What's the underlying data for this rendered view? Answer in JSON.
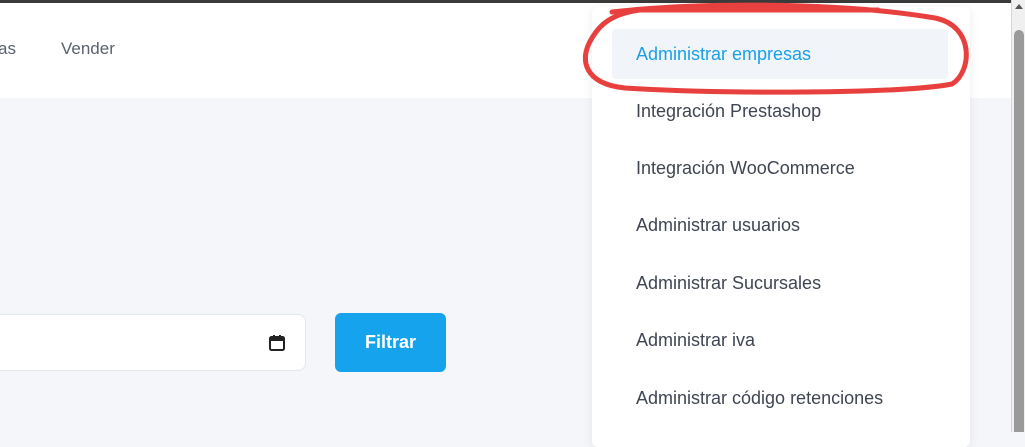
{
  "navbar": {
    "partial_link": "as",
    "sell_link": "Vender"
  },
  "filter": {
    "button_label": "Filtrar",
    "date_icon": "calendar-icon"
  },
  "dropdown": {
    "items": [
      {
        "label": "Administrar empresas",
        "active": true
      },
      {
        "label": "Integración Prestashop"
      },
      {
        "label": "Integración WooCommerce"
      },
      {
        "label": "Administrar usuarios"
      },
      {
        "label": "Administrar Sucursales"
      },
      {
        "label": "Administrar iva"
      },
      {
        "label": "Administrar código retenciones"
      }
    ]
  },
  "annotation": {
    "color": "#e8403e"
  },
  "colors": {
    "accent": "#16a3ee",
    "active_text": "#1aa0e8",
    "active_bg": "#f1f4f8",
    "page_bg": "#f4f6f9"
  }
}
